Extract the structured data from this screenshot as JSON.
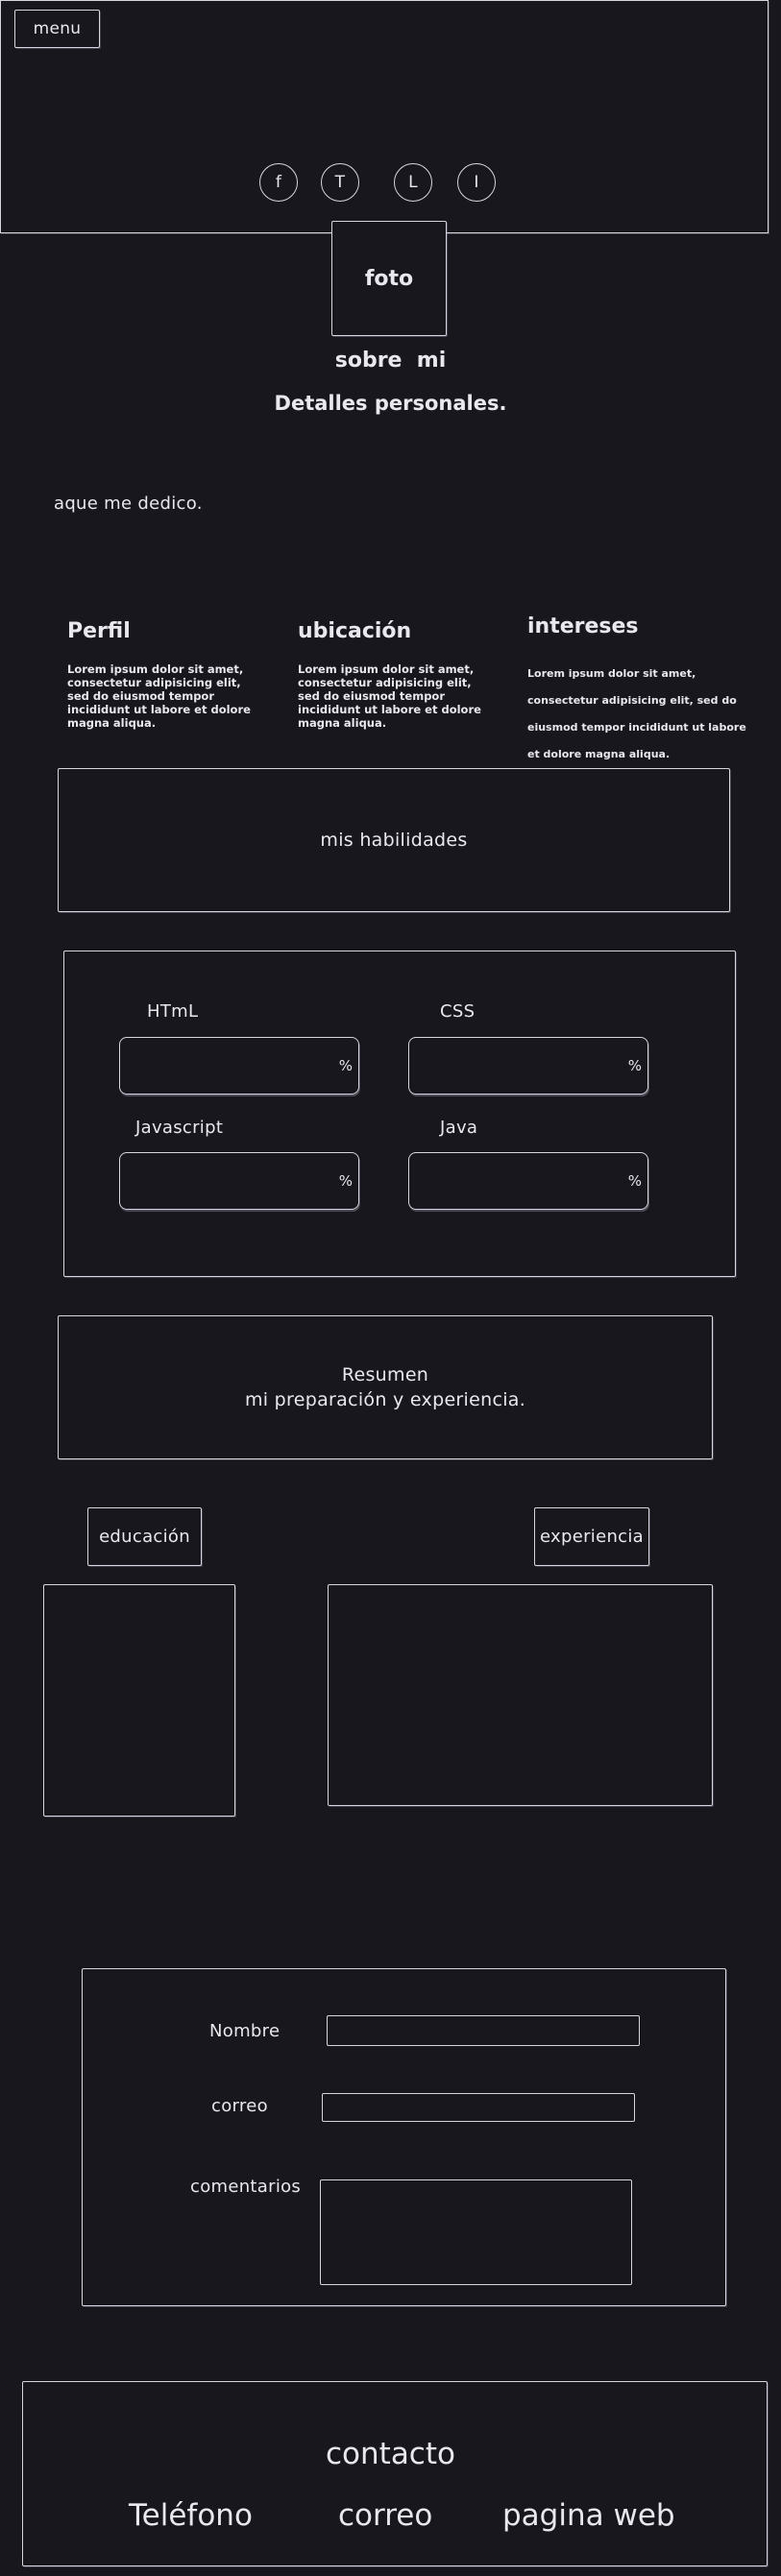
{
  "header": {
    "menu_label": "menu",
    "social": [
      {
        "label": "f",
        "icon": "facebook-icon"
      },
      {
        "label": "T",
        "icon": "twitter-icon"
      },
      {
        "label": "L",
        "icon": "linkedin-icon"
      },
      {
        "label": "I",
        "icon": "instagram-icon"
      }
    ]
  },
  "profile": {
    "photo_label": "foto",
    "about_title": "sobre  mi",
    "personal_title": "Detalles personales.",
    "dedico": "aque me dedico."
  },
  "columns": [
    {
      "title": "Perfil",
      "text": "Lorem ipsum dolor sit amet, consectetur adipisicing elit, sed do eiusmod tempor incididunt ut labore et dolore magna aliqua."
    },
    {
      "title": "ubicación",
      "text": "Lorem ipsum dolor sit amet, consectetur adipisicing elit, sed do eiusmod tempor incididunt ut labore et dolore magna aliqua."
    },
    {
      "title": "intereses",
      "text": "Lorem ipsum dolor sit amet, consectetur adipisicing elit, sed do eiusmod tempor incididunt ut labore et dolore magna aliqua."
    }
  ],
  "skills": {
    "banner": "mis habilidades",
    "items": [
      {
        "label": "HTmL",
        "unit": "%"
      },
      {
        "label": "CSS",
        "unit": "%"
      },
      {
        "label": "Javascript",
        "unit": "%"
      },
      {
        "label": "Java",
        "unit": "%"
      }
    ]
  },
  "resume": {
    "line1": "Resumen",
    "line2": "mi preparación y experiencia.",
    "education_tab": "educación",
    "experience_tab": "experiencia"
  },
  "form": {
    "name_label": "Nombre",
    "email_label": "correo",
    "comments_label": "comentarios"
  },
  "contact": {
    "title": "contacto",
    "items": [
      "Teléfono",
      "correo",
      "pagina web"
    ]
  },
  "colors": {
    "background": "#18171d",
    "stroke": "#d6d6e0",
    "text": "#e8e8ee"
  }
}
